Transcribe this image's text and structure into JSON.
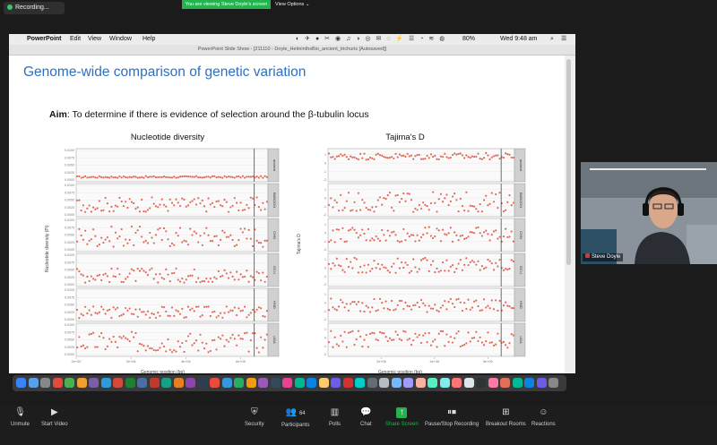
{
  "zoom": {
    "recording_label": "Recording...",
    "viewing_banner": "You are viewing Steve Doyle's screen",
    "view_options_label": "View Options ⌄",
    "participant_count": "64",
    "toolbar": [
      {
        "label": "Unmute",
        "icon": "microphone-muted-icon"
      },
      {
        "label": "Start Video",
        "icon": "video-off-icon"
      },
      {
        "label": "Security",
        "icon": "shield-icon"
      },
      {
        "label": "Participants",
        "icon": "participants-icon"
      },
      {
        "label": "Polls",
        "icon": "polls-icon"
      },
      {
        "label": "Chat",
        "icon": "chat-icon"
      },
      {
        "label": "Share Screen",
        "icon": "share-screen-icon"
      },
      {
        "label": "Pause/Stop Recording",
        "icon": "pause-stop-icon"
      },
      {
        "label": "Breakout Rooms",
        "icon": "breakout-rooms-icon"
      },
      {
        "label": "Reactions",
        "icon": "reactions-icon"
      }
    ],
    "webcam_name": "Steve Doyle",
    "colors": {
      "accent_green": "#24b34f",
      "background": "#1b1b1b"
    }
  },
  "mac": {
    "app_name": "PowerPoint",
    "menu": [
      "Edit",
      "View",
      "Window",
      "Help"
    ],
    "battery": "80%",
    "clock": "Wed 9:48 am",
    "window_title": "PowerPoint Slide Show - [211110 - Doyle_HelminthsBio_ancient_trichuris [Autosaved]]"
  },
  "slide": {
    "title": "Genome-wide comparison of genetic variation",
    "aim_label": "Aim",
    "aim_text": ": To determine if there is evidence of selection around the β-tubulin locus",
    "colors": {
      "title": "#2e6fc0",
      "points": "#e06a5a"
    }
  },
  "chart_data": [
    {
      "type": "scatter",
      "title": "Nucleotide diversity",
      "xlabel": "Genomic position (bp)",
      "ylabel": "Nucleotide diversity (Pi)",
      "x_ticks": [
        "0e+00",
        "2e+06",
        "4e+06",
        "6e+06"
      ],
      "y_ticks": [
        "0.0100",
        "0.0075",
        "0.0050",
        "0.0025",
        "0.0000"
      ],
      "ylim": [
        0,
        0.01
      ],
      "marker_line_x": 6500000,
      "panels": [
        {
          "name": "ancient",
          "mean": 0.001,
          "spread": 0.0003
        },
        {
          "name": "BABOON",
          "mean": 0.0035,
          "spread": 0.0025
        },
        {
          "name": "CHN",
          "mean": 0.0045,
          "spread": 0.0035
        },
        {
          "name": "ECU",
          "mean": 0.0032,
          "spread": 0.0025
        },
        {
          "name": "HND",
          "mean": 0.0025,
          "spread": 0.002
        },
        {
          "name": "UGA",
          "mean": 0.0042,
          "spread": 0.0035
        }
      ]
    },
    {
      "type": "scatter",
      "title": "Tajima's D",
      "xlabel": "Genomic position (bp)",
      "ylabel": "Tajima's D",
      "x_ticks": [
        "2e+06",
        "4e+06",
        "6e+06"
      ],
      "y_ticks": [
        "1",
        "0",
        "-1",
        "-2"
      ],
      "ylim": [
        -2,
        1.5
      ],
      "marker_line_x": 6500000,
      "panels": [
        {
          "name": "ancient",
          "mean": 0.8,
          "spread": 0.4
        },
        {
          "name": "BABOON",
          "mean": -0.5,
          "spread": 1.2
        },
        {
          "name": "CHN",
          "mean": -0.2,
          "spread": 0.9
        },
        {
          "name": "ECU",
          "mean": 0.3,
          "spread": 0.9
        },
        {
          "name": "HND",
          "mean": -0.3,
          "spread": 0.8
        },
        {
          "name": "UGA",
          "mean": -0.2,
          "spread": 1.0
        }
      ]
    }
  ]
}
